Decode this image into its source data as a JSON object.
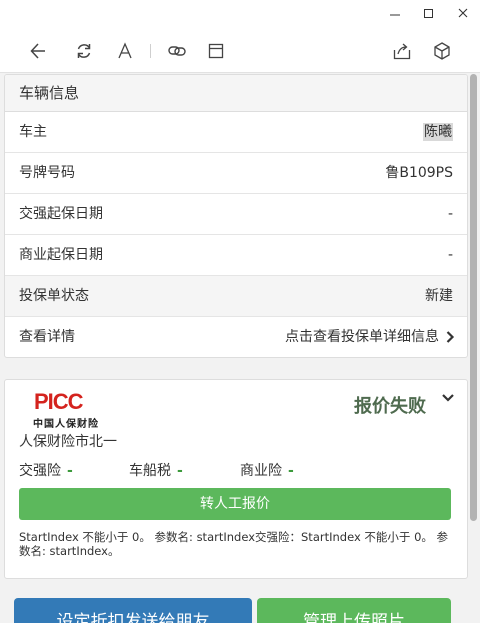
{
  "vehicle": {
    "header": "车辆信息",
    "rows": [
      {
        "label": "车主",
        "value": "陈曦"
      },
      {
        "label": "号牌号码",
        "value": "鲁B109PS"
      },
      {
        "label": "交强起保日期",
        "value": "-"
      },
      {
        "label": "商业起保日期",
        "value": "-"
      },
      {
        "label": "投保单状态",
        "value": "新建"
      },
      {
        "label": "查看详情",
        "value": "点击查看投保单详细信息"
      }
    ]
  },
  "quote": {
    "logo_text": "PICC",
    "logo_sub": "中国人保财险",
    "status": "报价失败",
    "company": "人保财险市北一",
    "items": [
      {
        "label": "交强险",
        "value": "-"
      },
      {
        "label": "车船税",
        "value": "-"
      },
      {
        "label": "商业险",
        "value": "-"
      }
    ],
    "manual_button": "转人工报价",
    "error": "StartIndex 不能小于 0。 参数名: startIndex交强险：StartIndex 不能小于 0。 参数名: startIndex。"
  },
  "bottom": {
    "share_button": "设定折扣发送给朋友",
    "upload_button": "管理上传照片"
  },
  "colors": {
    "accent_green": "#5cb85c",
    "accent_blue": "#337ab7",
    "brand_red": "#d4231e",
    "status_text": "#4f6b4f"
  }
}
